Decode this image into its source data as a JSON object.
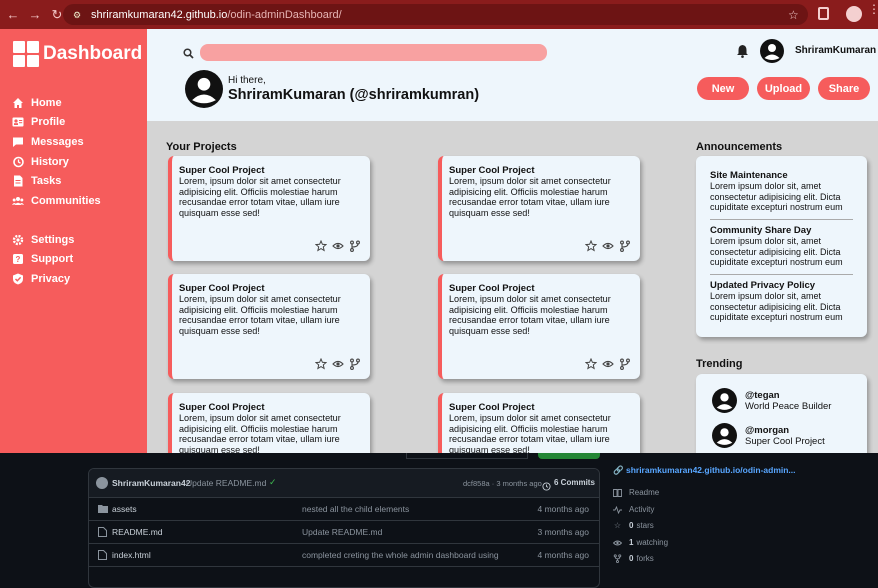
{
  "browser": {
    "url_host": "shriramkumaran42.github.io",
    "url_path": "/odin-adminDashboard/"
  },
  "sidebar": {
    "title": "Dashboard",
    "items": [
      {
        "label": "Home",
        "icon": "home-icon"
      },
      {
        "label": "Profile",
        "icon": "profile-card-icon"
      },
      {
        "label": "Messages",
        "icon": "message-icon"
      },
      {
        "label": "History",
        "icon": "history-icon"
      },
      {
        "label": "Tasks",
        "icon": "tasks-icon"
      },
      {
        "label": "Communities",
        "icon": "communities-icon"
      }
    ],
    "items2": [
      {
        "label": "Settings",
        "icon": "gear-icon"
      },
      {
        "label": "Support",
        "icon": "support-icon"
      },
      {
        "label": "Privacy",
        "icon": "shield-icon"
      }
    ]
  },
  "header": {
    "username": "ShriramKumaran",
    "greeting": "Hi there,",
    "handle": "ShriramKumaran (@shriramkumran)",
    "buttons": [
      "New",
      "Upload",
      "Share"
    ]
  },
  "projects": {
    "heading": "Your Projects",
    "cards": [
      {
        "title": "Super Cool Project",
        "body": "Lorem, ipsum dolor sit amet consectetur adipisicing elit. Officiis molestiae harum recusandae error totam vitae, ullam iure quisquam esse sed!"
      },
      {
        "title": "Super Cool Project",
        "body": "Lorem, ipsum dolor sit amet consectetur adipisicing elit. Officiis molestiae harum recusandae error totam vitae, ullam iure quisquam esse sed!"
      },
      {
        "title": "Super Cool Project",
        "body": "Lorem, ipsum dolor sit amet consectetur adipisicing elit. Officiis molestiae harum recusandae error totam vitae, ullam iure quisquam esse sed!"
      },
      {
        "title": "Super Cool Project",
        "body": "Lorem, ipsum dolor sit amet consectetur adipisicing elit. Officiis molestiae harum recusandae error totam vitae, ullam iure quisquam esse sed!"
      },
      {
        "title": "Super Cool Project",
        "body": "Lorem, ipsum dolor sit amet consectetur adipisicing elit. Officiis molestiae harum recusandae error totam vitae, ullam iure quisquam esse sed!"
      },
      {
        "title": "Super Cool Project",
        "body": "Lorem, ipsum dolor sit amet consectetur adipisicing elit. Officiis molestiae harum recusandae error totam vitae, ullam iure quisquam esse sed!"
      }
    ]
  },
  "announcements": {
    "heading": "Announcements",
    "items": [
      {
        "title": "Site Maintenance",
        "body": "Lorem ipsum dolor sit, amet consectetur adipisicing elit. Dicta cupiditate excepturi nostrum eum"
      },
      {
        "title": "Community Share Day",
        "body": "Lorem ipsum dolor sit, amet consectetur adipisicing elit. Dicta cupiditate excepturi nostrum eum"
      },
      {
        "title": "Updated Privacy Policy",
        "body": "Lorem ipsum dolor sit, amet consectetur adipisicing elit. Dicta cupiditate excepturi nostrum eum"
      }
    ]
  },
  "trending": {
    "heading": "Trending",
    "items": [
      {
        "name": "@tegan",
        "desc": "World Peace Builder"
      },
      {
        "name": "@morgan",
        "desc": "Super Cool Project"
      }
    ]
  },
  "github": {
    "commit_user": "ShriramKumaran42",
    "commit_msg": "Update README.md",
    "commit_meta": "dcf858a · 3 months ago",
    "commits": "6 Commits",
    "files": [
      {
        "name": "assets",
        "msg": "nested all the child elements",
        "date": "4 months ago",
        "type": "folder"
      },
      {
        "name": "README.md",
        "msg": "Update README.md",
        "date": "3 months ago",
        "type": "file"
      },
      {
        "name": "index.html",
        "msg": "completed creting the whole admin dashboard using",
        "date": "4 months ago",
        "type": "file"
      }
    ],
    "about": {
      "link": "shriramkumaran42.github.io/odin-admin...",
      "readme": "Readme",
      "activity": "Activity",
      "stars_n": "0",
      "stars": "stars",
      "watching_n": "1",
      "watching": "watching",
      "forks_n": "0",
      "forks": "forks"
    }
  }
}
